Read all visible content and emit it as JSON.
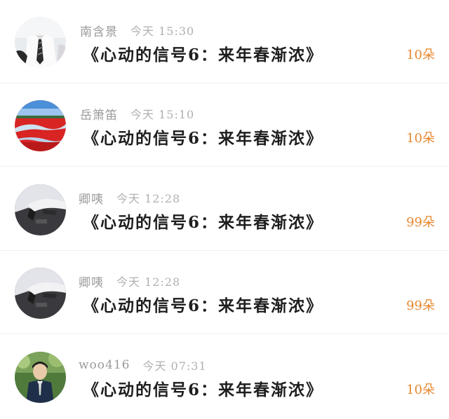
{
  "messages": [
    {
      "name": "南含景",
      "time": "今天 15:30",
      "text": "《心动的信号6：来年春渐浓》",
      "count": "10朵",
      "avatar": "boy-in-uniform-photo"
    },
    {
      "name": "岳箫笛",
      "time": "今天 15:10",
      "text": "《心动的信号6：来年春渐浓》",
      "count": "10朵",
      "avatar": "red-field-landscape-photo"
    },
    {
      "name": "卿咦",
      "time": "今天 12:28",
      "text": "《心动的信号6：来年春渐浓》",
      "count": "99朵",
      "avatar": "dark-abstract-photo"
    },
    {
      "name": "卿咦",
      "time": "今天 12:28",
      "text": "《心动的信号6：来年春渐浓》",
      "count": "99朵",
      "avatar": "dark-abstract-photo"
    },
    {
      "name": "woo416",
      "time": "今天 07:31",
      "text": "《心动的信号6：来年春渐浓》",
      "count": "10朵",
      "avatar": "man-in-suit-photo"
    }
  ],
  "colors": {
    "count": "#e8872f",
    "name": "#9a9a9a",
    "time": "#b0b0b0",
    "message": "#1e1e1e"
  }
}
